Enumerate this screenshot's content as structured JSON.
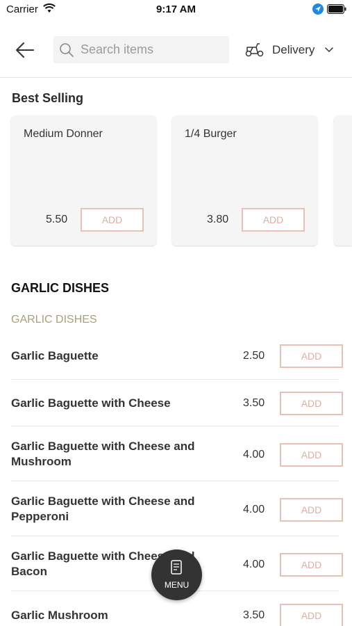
{
  "status_bar": {
    "carrier": "Carrier",
    "time": "9:17 AM"
  },
  "header": {
    "search_placeholder": "Search items",
    "order_mode": "Delivery"
  },
  "best_selling": {
    "title": "Best Selling",
    "items": [
      {
        "name": "Medium Donner",
        "price": "5.50",
        "add_label": "ADD"
      },
      {
        "name": "1/4  Burger",
        "price": "3.80",
        "add_label": "ADD"
      }
    ]
  },
  "category": {
    "title": "GARLIC DISHES",
    "subcategory": "GARLIC DISHES",
    "items": [
      {
        "name": "Garlic Baguette",
        "price": "2.50",
        "add_label": "ADD"
      },
      {
        "name": "Garlic Baguette with Cheese",
        "price": "3.50",
        "add_label": "ADD"
      },
      {
        "name": "Garlic Baguette with Cheese and Mushroom",
        "price": "4.00",
        "add_label": "ADD"
      },
      {
        "name": "Garlic Baguette with Cheese and Pepperoni",
        "price": "4.00",
        "add_label": "ADD"
      },
      {
        "name": "Garlic Baguette with Cheese and Bacon",
        "price": "4.00",
        "add_label": "ADD"
      },
      {
        "name": "Garlic Mushroom",
        "price": "3.50",
        "add_label": "ADD"
      }
    ]
  },
  "menu_button": {
    "label": "MENU"
  },
  "colors": {
    "add_border": "#e8c0b6",
    "add_text": "#e0aea2",
    "subcategory": "#a89f7a",
    "fab": "#333333",
    "location_blue": "#1e88e5"
  },
  "icons": {
    "back": "arrow-left-icon",
    "search": "search-icon",
    "delivery": "scooter-icon",
    "dropdown": "chevron-down-icon",
    "menu": "menu-book-icon"
  }
}
